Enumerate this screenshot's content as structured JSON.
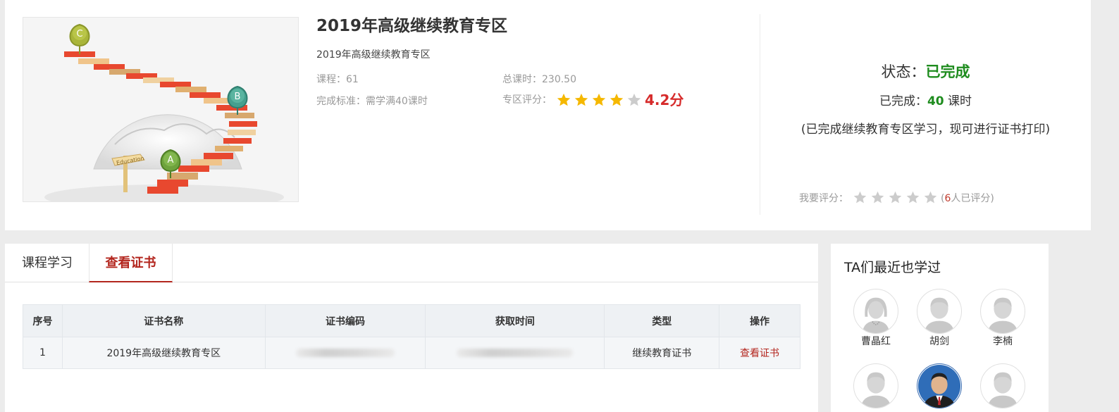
{
  "course": {
    "title": "2019年高级继续教育专区",
    "subtitle": "2019年高级继续教育专区",
    "courses_label": "课程：",
    "courses_value": "61",
    "hours_label": "总课时：",
    "hours_value": "230.50",
    "standard_label": "完成标准：",
    "standard_value": "需学满40课时",
    "rating_label": "专区评分：",
    "rating_stars": 4,
    "rating_score": "4.2分",
    "cover_markers": [
      "C",
      "B",
      "A"
    ],
    "cover_sign": "Education"
  },
  "status": {
    "label": "状态：",
    "value": "已完成",
    "done_label": "已完成：",
    "done_hours": "40",
    "done_unit": " 课时",
    "note": "(已完成继续教育专区学习，现可进行证书打印)",
    "rate_label": "我要评分：",
    "rate_count_open": "(",
    "rate_count_num": "6",
    "rate_count_tail": "人已评分)"
  },
  "tabs": [
    {
      "label": "课程学习"
    },
    {
      "label": "查看证书"
    }
  ],
  "table": {
    "headers": [
      "序号",
      "证书名称",
      "证书编码",
      "获取时间",
      "类型",
      "操作"
    ],
    "rows": [
      {
        "index": "1",
        "name": "2019年高级继续教育专区",
        "type": "继续教育证书",
        "action": "查看证书"
      }
    ]
  },
  "sidebar": {
    "title": "TA们最近也学过",
    "peers": [
      {
        "name": "曹晶红"
      },
      {
        "name": "胡剑"
      },
      {
        "name": "李楠"
      },
      {
        "name": ""
      },
      {
        "name": ""
      },
      {
        "name": ""
      }
    ]
  },
  "colors": {
    "accent_red": "#b3261e",
    "success_green": "#1e8c1e",
    "star_gold": "#f5b800",
    "star_empty": "#cccccc"
  }
}
